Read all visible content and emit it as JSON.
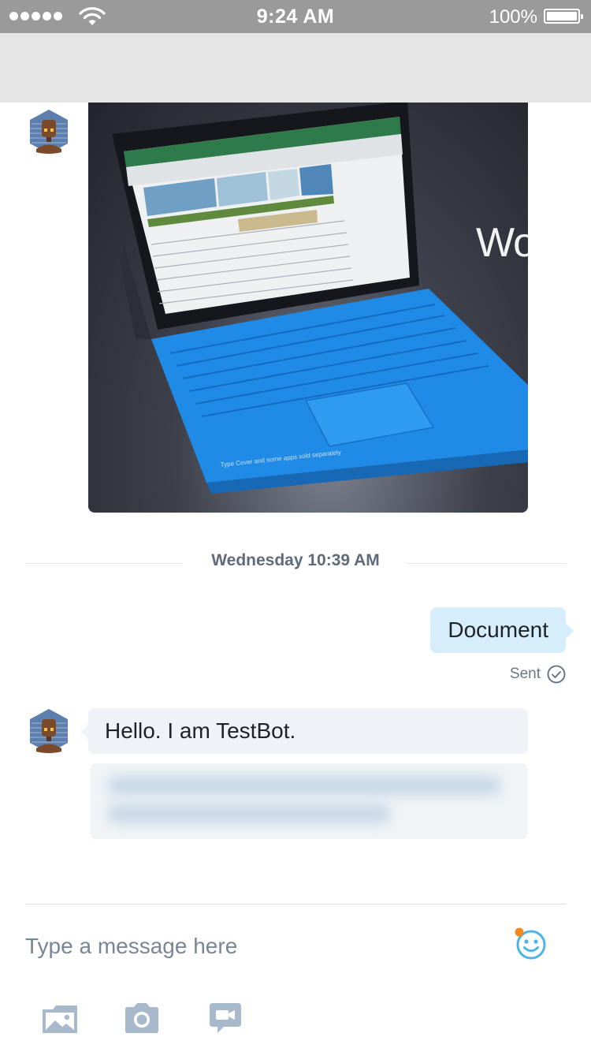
{
  "status_bar": {
    "time": "9:24 AM",
    "battery_percent": "100%",
    "signal_bars": 5
  },
  "conversation": {
    "date_separator": "Wednesday 10:39 AM",
    "sent_message": {
      "text": "Document",
      "status": "Sent"
    },
    "received_message": {
      "text": "Hello. I am TestBot."
    },
    "image_caption_partial": "Wo"
  },
  "composer": {
    "placeholder": "Type a message here"
  },
  "icons": {
    "emoji": "smiley-icon",
    "gallery": "gallery-icon",
    "camera": "camera-icon",
    "video_message": "video-message-icon"
  },
  "colors": {
    "accent": "#4fb3ea",
    "notification_dot": "#f48a1c",
    "outgoing_bubble": "#d6eefb",
    "incoming_bubble": "#eff2f6"
  }
}
